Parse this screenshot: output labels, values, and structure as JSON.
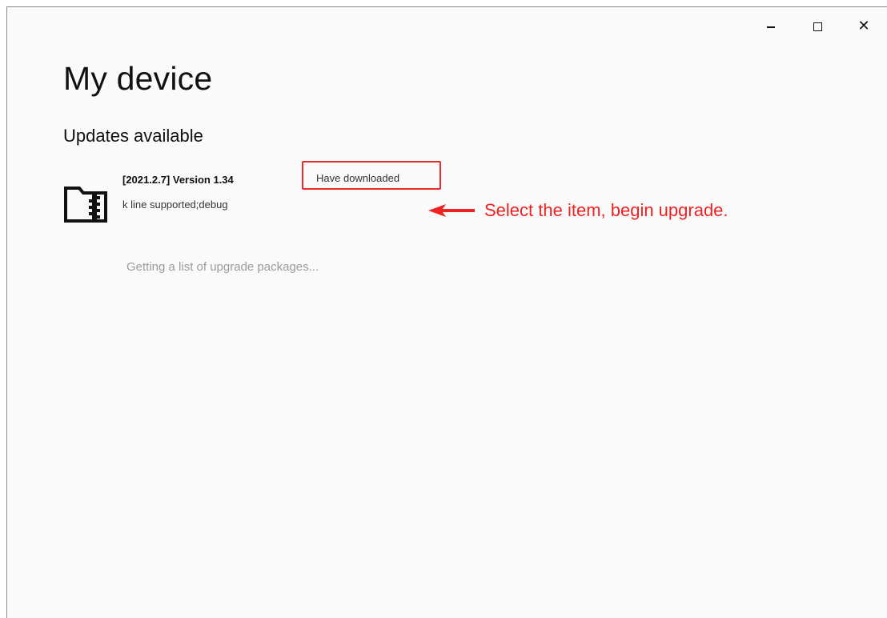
{
  "window": {
    "title": "My device",
    "controls": {
      "minimize_icon": "minimize-icon",
      "maximize_icon": "maximize-icon",
      "close_glyph": "✕"
    }
  },
  "section": {
    "title": "Updates available"
  },
  "updates": [
    {
      "icon": "zip-folder-icon",
      "title": "[2021.2.7] Version 1.34",
      "description": "k line supported;debug",
      "status": "Have downloaded"
    }
  ],
  "annotation": {
    "text": "Select the item, begin upgrade.",
    "color": "#ee2222"
  },
  "loading": {
    "text": "Getting a list of upgrade packages..."
  },
  "colors": {
    "background": "#fafafa",
    "highlight_border": "#ea2b2b",
    "muted_text": "#9b9b9b"
  }
}
